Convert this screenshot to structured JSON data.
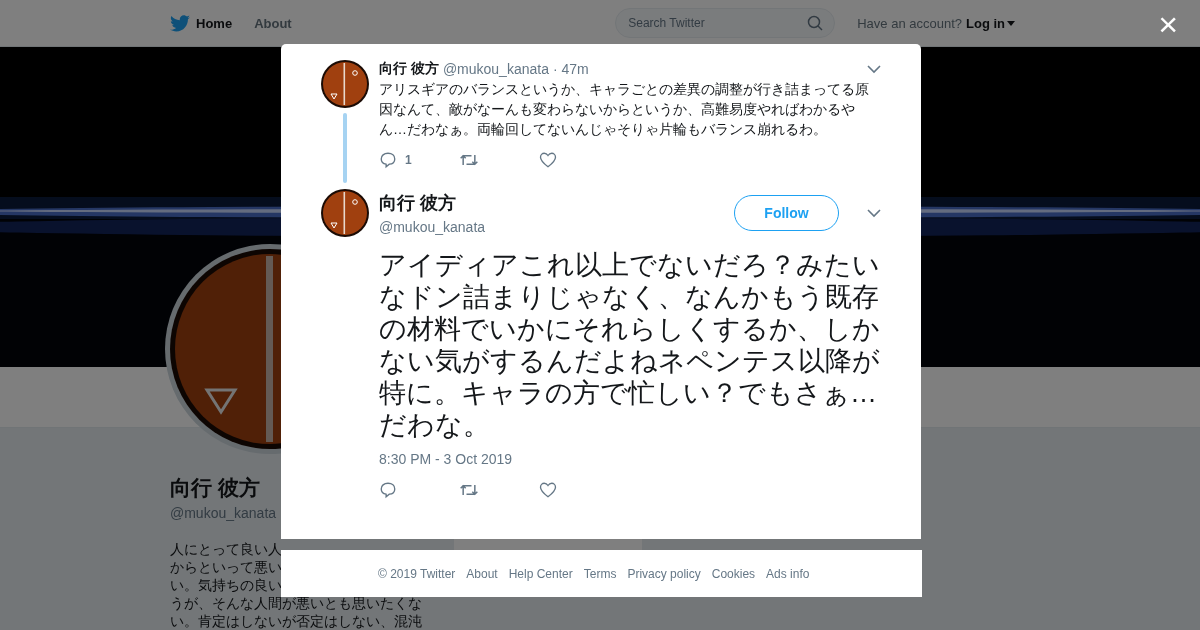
{
  "topbar": {
    "nav": [
      {
        "label": "Home",
        "selected": true
      },
      {
        "label": "About",
        "selected": false
      }
    ],
    "search": {
      "placeholder": "Search Twitter"
    },
    "account_prompt": "Have an account?",
    "login": "Log in"
  },
  "profile": {
    "name": "向行 彼方",
    "handle": "@mukou_kanata",
    "bio_lines": [
      "人にとって良い人",
      "からといって悪い",
      "い。気持ちの良い",
      "うが、そんな人間が悪いとも思いたくな",
      "い。肯定はしないが否定はしない、混沌"
    ]
  },
  "parent_tweet": {
    "name": "向行 彼方",
    "handle": "@mukou_kanata",
    "time": "· 47m",
    "text": "アリスギアのバランスというか、キャラごとの差異の調整が行き詰まってる原因なんて、敵がなーんも変わらないからというか、高難易度やればわかるやん…だわなぁ。両輪回してないんじゃそりゃ片輪もバランス崩れるわ。",
    "reply_count": "1"
  },
  "main_tweet": {
    "name": "向行 彼方",
    "handle": "@mukou_kanata",
    "follow": "Follow",
    "text": "アイディアこれ以上でないだろ？みたいなドン詰まりじゃなく、なんかもう既存の材料でいかにそれらしくするか、しかない気がするんだよねネペンテス以降が特に。キャラの方で忙しい？でもさぁ…だわな。",
    "timestamp": "8:30 PM - 3 Oct 2019"
  },
  "footer": [
    "© 2019 Twitter",
    "About",
    "Help Center",
    "Terms",
    "Privacy policy",
    "Cookies",
    "Ads info"
  ],
  "close": "×"
}
